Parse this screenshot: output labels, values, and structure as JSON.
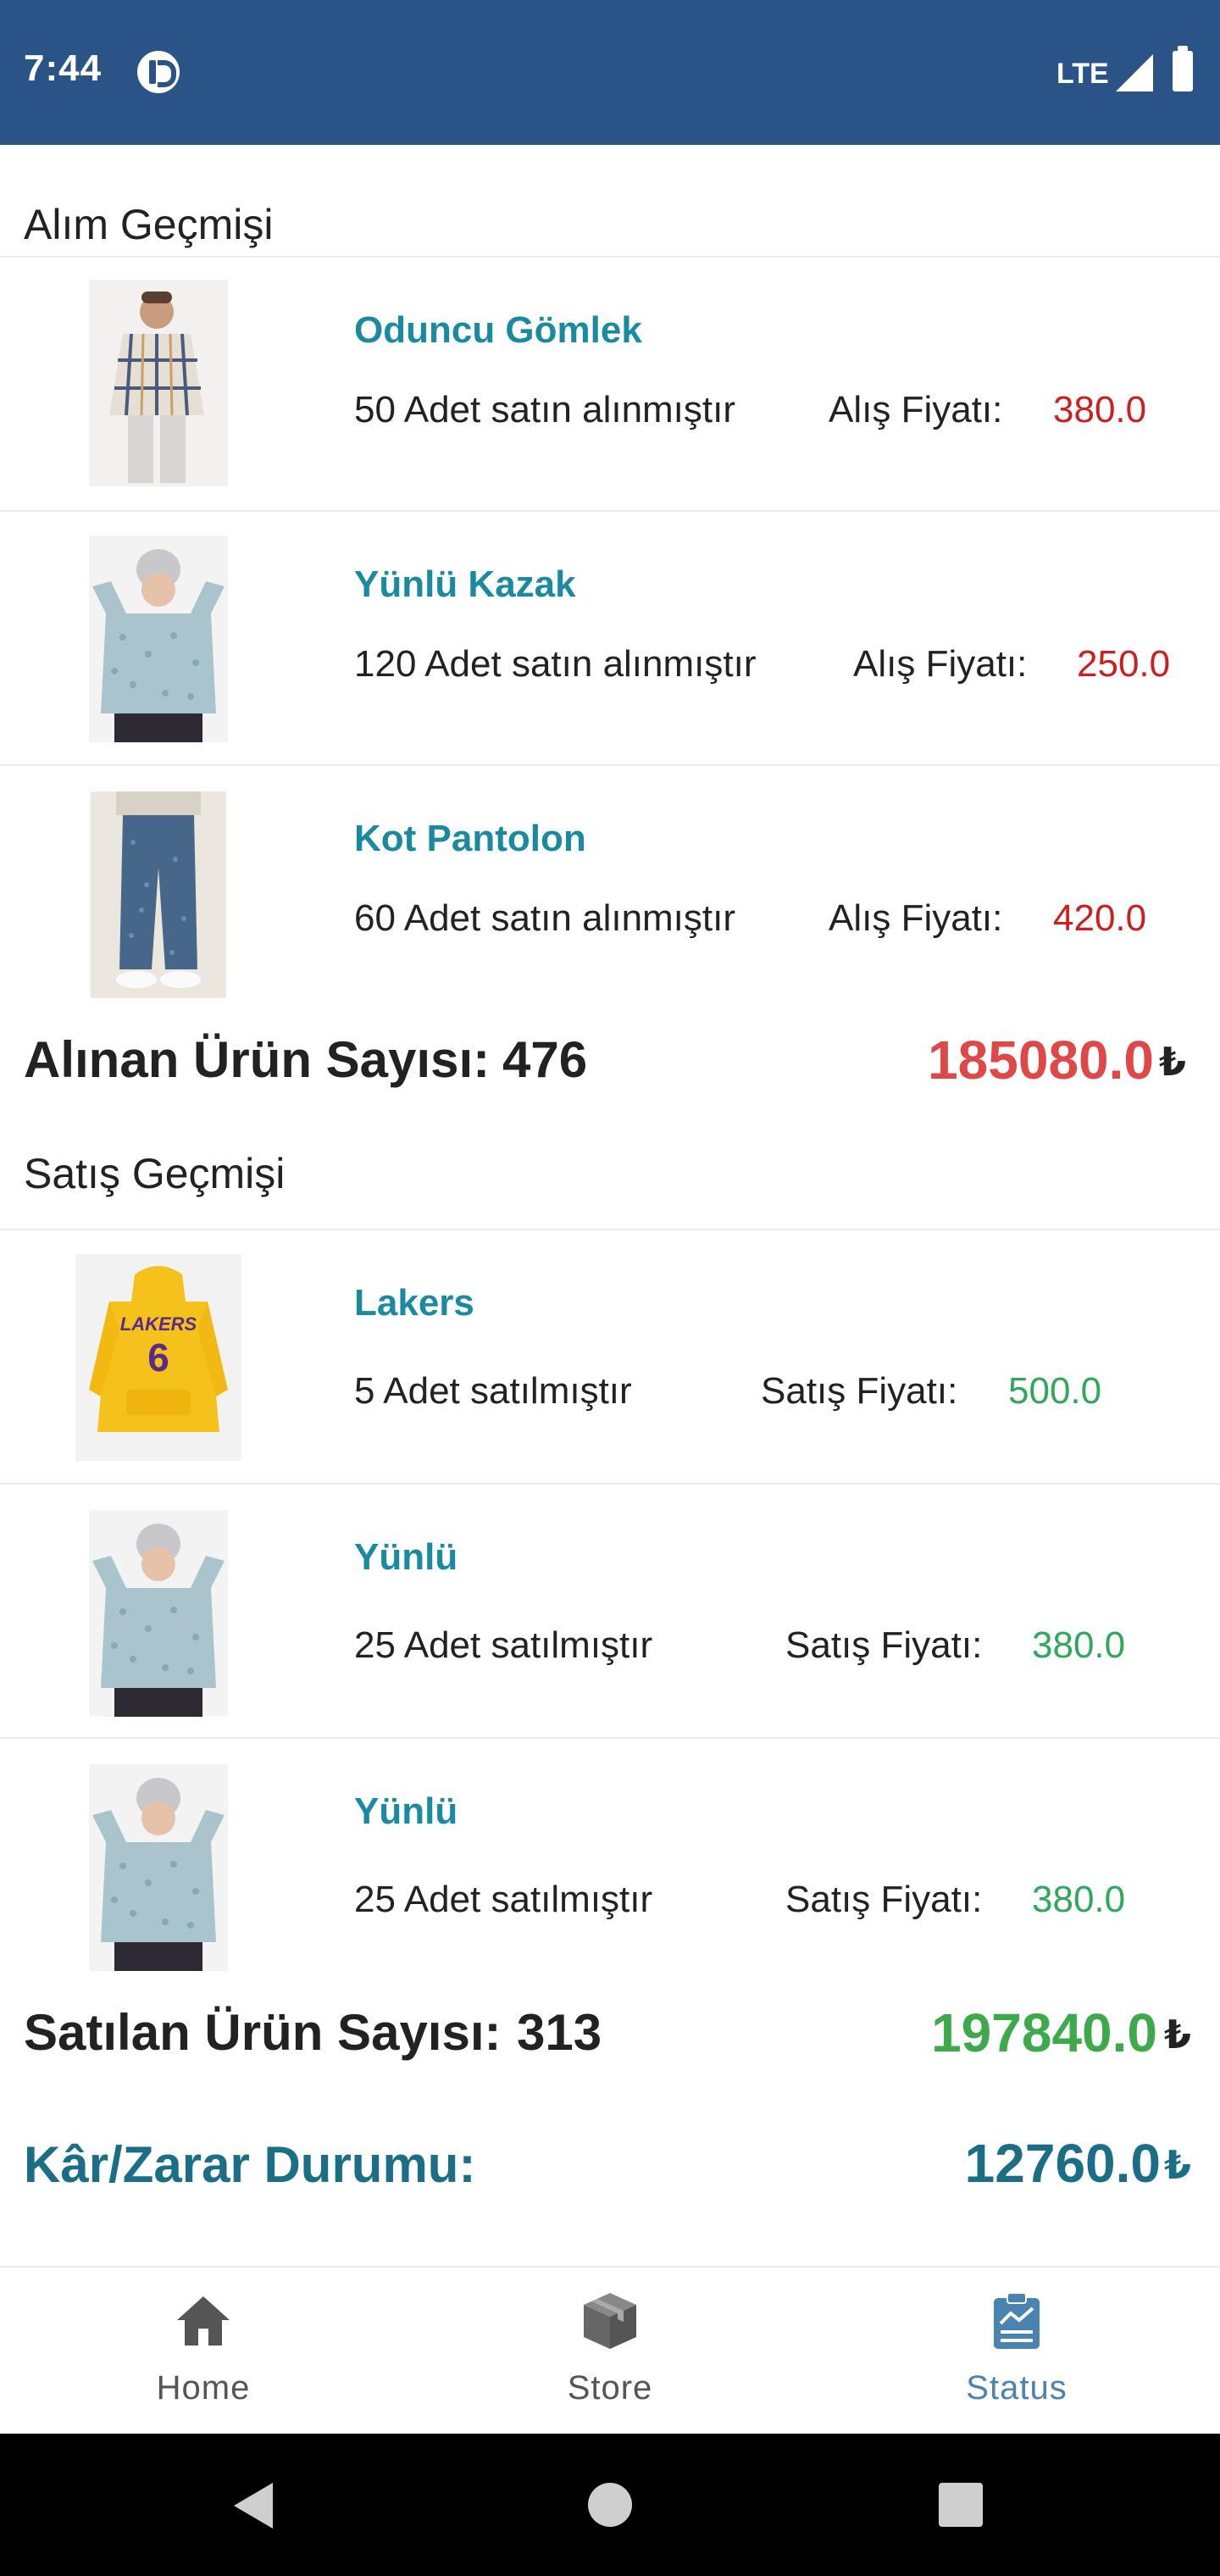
{
  "status_bar": {
    "time": "7:44",
    "network": "LTE"
  },
  "purchase_history": {
    "title": "Alım Geçmişi",
    "items": [
      {
        "name": "Oduncu Gömlek",
        "quantity_text": "50 Adet satın alınmıştır",
        "price_label": "Alış Fiyatı:",
        "price": "380.0"
      },
      {
        "name": "Yünlü Kazak",
        "quantity_text": "120 Adet satın alınmıştır",
        "price_label": "Alış Fiyatı:",
        "price": "250.0"
      },
      {
        "name": "Kot Pantolon",
        "quantity_text": "60 Adet satın alınmıştır",
        "price_label": "Alış Fiyatı:",
        "price": "420.0"
      }
    ],
    "summary_label": "Alınan Ürün Sayısı:",
    "summary_count": "476",
    "summary_total": "185080.0"
  },
  "sales_history": {
    "title": "Satış Geçmişi",
    "items": [
      {
        "name": "Lakers",
        "quantity_text": "5 Adet satılmıştır",
        "price_label": "Satış Fiyatı:",
        "price": "500.0"
      },
      {
        "name": "Yünlü",
        "quantity_text": "25 Adet satılmıştır",
        "price_label": "Satış Fiyatı:",
        "price": "380.0"
      },
      {
        "name": "Yünlü",
        "quantity_text": "25 Adet satılmıştır",
        "price_label": "Satış Fiyatı:",
        "price": "380.0"
      }
    ],
    "summary_label": "Satılan Ürün Sayısı:",
    "summary_count": "313",
    "summary_total": "197840.0"
  },
  "profit": {
    "label": "Kâr/Zarar Durumu:",
    "total": "12760.0"
  },
  "currency_symbol": "₺",
  "bottom_nav": {
    "items": [
      {
        "label": "Home",
        "icon": "home-icon"
      },
      {
        "label": "Store",
        "icon": "box-icon"
      },
      {
        "label": "Status",
        "icon": "clipboard-chart-icon",
        "active": true
      }
    ]
  },
  "colors": {
    "status_bar": "#2a5488",
    "product_name": "#1a8aa0",
    "purchase_price": "#cc1f1f",
    "sale_price": "#2ea85a",
    "profit": "#1a6f86",
    "nav_active": "#4b83b0"
  }
}
